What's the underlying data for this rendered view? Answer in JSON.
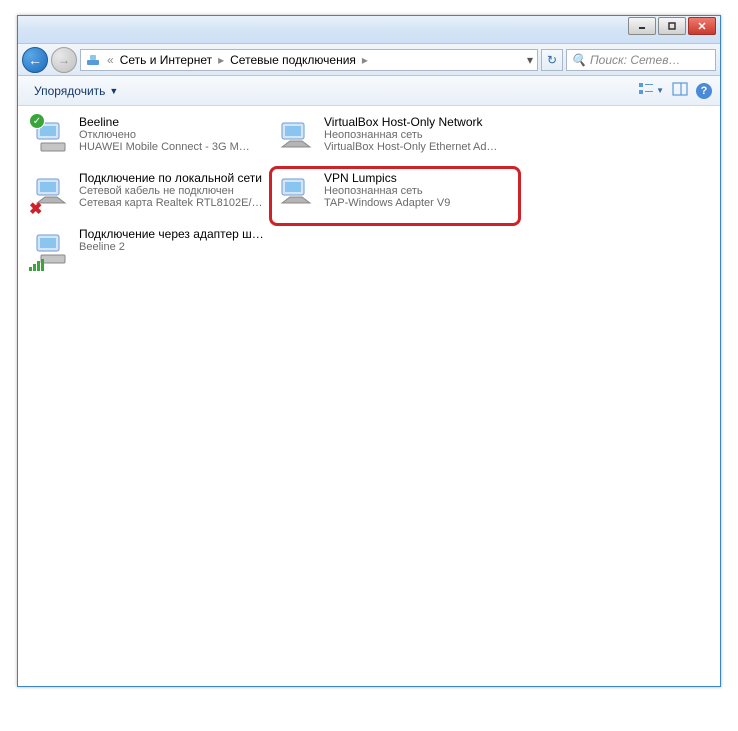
{
  "breadcrumb": {
    "part1": "Сеть и Интернет",
    "part2": "Сетевые подключения"
  },
  "search": {
    "placeholder": "Поиск: Сетев…"
  },
  "toolbar": {
    "organize": "Упорядочить"
  },
  "connections": [
    {
      "name": "Beeline",
      "status": "Отключено",
      "adapter": "HUAWEI Mobile Connect - 3G M…"
    },
    {
      "name": "VirtualBox Host-Only Network",
      "status": "Неопознанная сеть",
      "adapter": "VirtualBox Host-Only Ethernet Ad…"
    },
    {
      "name": "Подключение по локальной сети",
      "status": "Сетевой кабель не подключен",
      "adapter": "Сетевая карта Realtek RTL8102E/…"
    },
    {
      "name": "VPN Lumpics",
      "status": "Неопознанная сеть",
      "adapter": "TAP-Windows Adapter V9"
    },
    {
      "name": "Подключение через адаптер широкополосной мобильной с…",
      "status": "Beeline  2",
      "adapter": ""
    }
  ]
}
